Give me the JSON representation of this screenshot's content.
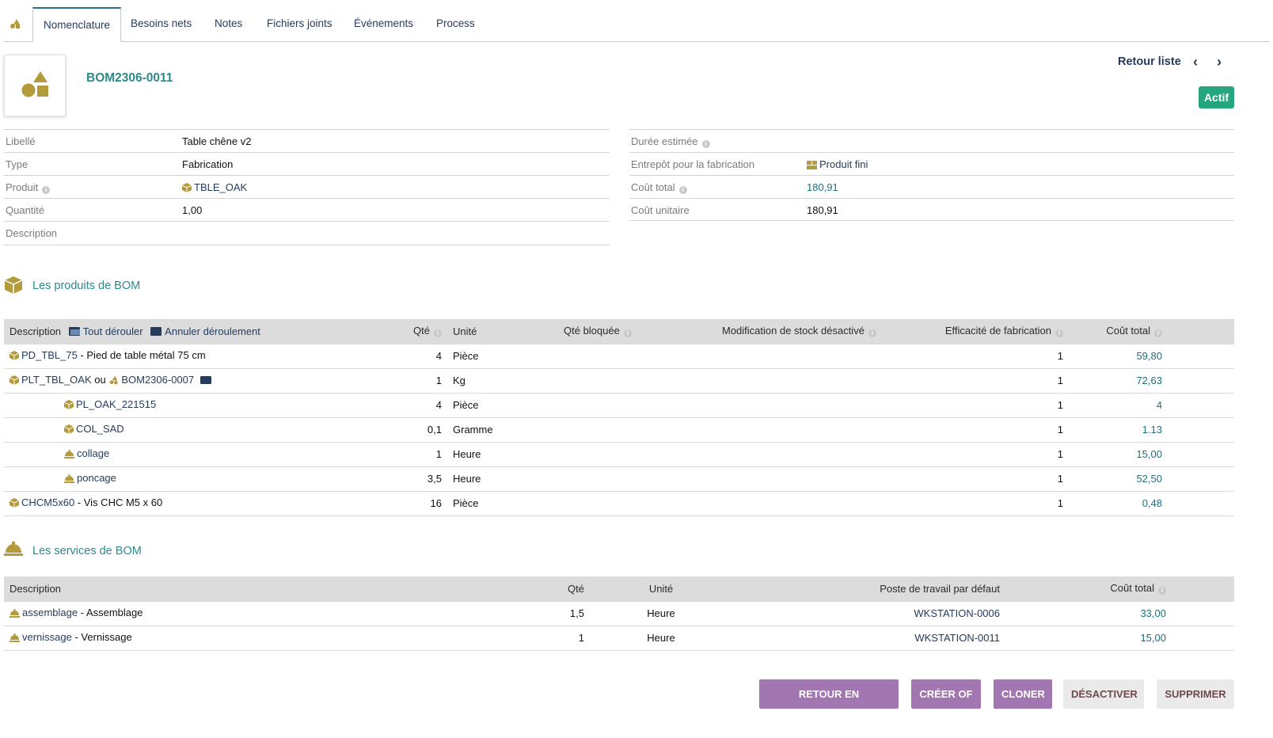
{
  "tabs": {
    "home_icon": "bom-icon",
    "items": [
      "Nomenclature",
      "Besoins nets",
      "Notes",
      "Fichiers joints",
      "Événements",
      "Process"
    ],
    "active": "Nomenclature"
  },
  "header": {
    "ref": "BOM2306-0011",
    "back_label": "Retour liste",
    "prev_label": "‹",
    "next_label": "›",
    "status": "Actif"
  },
  "fields_left": [
    {
      "label": "Libellé",
      "value": "Table chêne v2"
    },
    {
      "label": "Type",
      "value": "Fabrication"
    },
    {
      "label": "Produit",
      "value": "TBLE_OAK"
    },
    {
      "label": "Quantité",
      "value": "1,00"
    },
    {
      "label": "Description",
      "value": ""
    }
  ],
  "fields_right": [
    {
      "label": "Durée estimée",
      "value": ""
    },
    {
      "label": "Entrepôt pour la fabrication",
      "value": "Produit fini"
    },
    {
      "label": "Coût total",
      "value": "180,91"
    },
    {
      "label": "Coût unitaire",
      "value": "180,91"
    }
  ],
  "products_section": {
    "title": "Les produits de BOM",
    "headers": {
      "description": "Description",
      "expand_all": "Tout dérouler",
      "collapse_all": "Annuler déroulement",
      "qty": "Qté",
      "unit": "Unité",
      "blocked_qty": "Qté bloquée",
      "stock_mod": "Modification de stock désactivé",
      "efficiency": "Efficacité de fabrication",
      "total_cost": "Coût total"
    },
    "rows": [
      {
        "ref": "PD_TBL_75",
        "label": " - Pied de table métal 75 cm",
        "qty": "4",
        "unit": "Pièce",
        "eff": "1",
        "cost": "59,80"
      },
      {
        "ref": "PLT_TBL_OAK",
        "or_text": " ou ",
        "bom_ref": "BOM2306-0007",
        "qty": "1",
        "unit": "Kg",
        "eff": "1",
        "cost": "72,63"
      },
      {
        "ref": "PL_OAK_221515",
        "qty": "4",
        "unit": "Pièce",
        "eff": "1",
        "cost": "4"
      },
      {
        "ref": "COL_SAD",
        "qty": "0,1",
        "unit": "Gramme",
        "eff": "1",
        "cost": "1.13"
      },
      {
        "ref": "collage",
        "qty": "1",
        "unit": "Heure",
        "eff": "1",
        "cost": "15,00"
      },
      {
        "ref": "poncage",
        "qty": "3,5",
        "unit": "Heure",
        "eff": "1",
        "cost": "52,50"
      },
      {
        "ref": "CHCM5x60",
        "label": " - Vis CHC M5 x 60",
        "qty": "16",
        "unit": "Pièce",
        "eff": "1",
        "cost": "0,48"
      }
    ]
  },
  "services_section": {
    "title": "Les services de BOM",
    "headers": {
      "description": "Description",
      "qty": "Qté",
      "unit": "Unité",
      "workstation": "Poste de travail par défaut",
      "total_cost": "Coût total"
    },
    "rows": [
      {
        "ref": "assemblage",
        "label": " - Assemblage",
        "qty": "1,5",
        "unit": "Heure",
        "workstation": "WKSTATION-0006",
        "cost": "33,00"
      },
      {
        "ref": "vernissage",
        "label": " - Vernissage",
        "qty": "1",
        "unit": "Heure",
        "workstation": "WKSTATION-0011",
        "cost": "15,00"
      }
    ]
  },
  "actions": {
    "draft": "RETOUR EN BROUILLON",
    "create_mo": "CRÉER OF",
    "clone": "CLONER",
    "disable": "DÉSACTIVER",
    "delete": "SUPPRIMER"
  },
  "colors": {
    "accent": "#2c8a8a",
    "link": "#263c5c",
    "status": "#25a580",
    "button_primary": "#a276b1",
    "icon": "#b39a3b"
  }
}
